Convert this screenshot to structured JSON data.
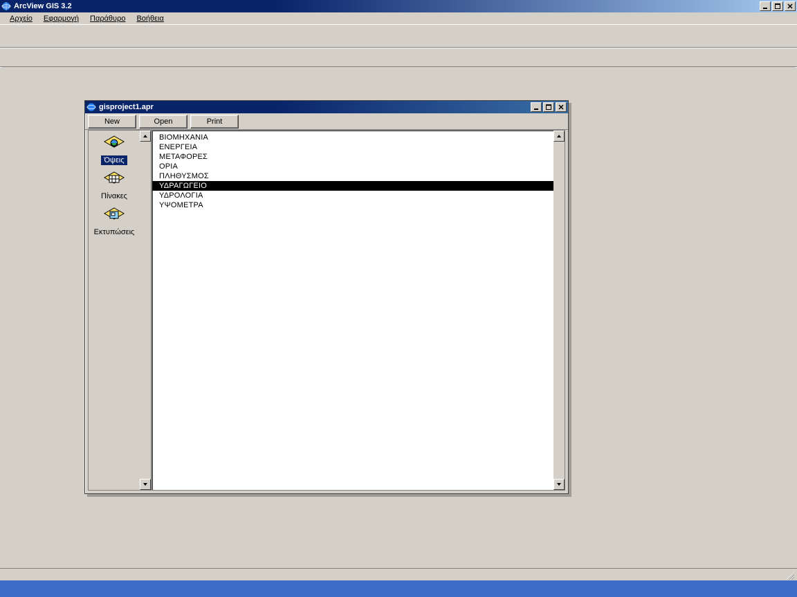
{
  "app": {
    "title": "ArcView GIS 3.2"
  },
  "menubar": {
    "items": [
      {
        "label": "Αρχείο"
      },
      {
        "label": "Εφαρμογή"
      },
      {
        "label": "Παράθυρο"
      },
      {
        "label": "Βοήθεια"
      }
    ]
  },
  "project_window": {
    "title": "gisproject1.apr",
    "buttons": {
      "new": "New",
      "open": "Open",
      "print": "Print"
    },
    "sidebar": {
      "items": [
        {
          "label": "Όψεις",
          "icon": "views-icon",
          "selected": true
        },
        {
          "label": "Πίνακες",
          "icon": "tables-icon",
          "selected": false
        },
        {
          "label": "Εκτυπώσεις",
          "icon": "layouts-icon",
          "selected": false
        }
      ]
    },
    "list": {
      "items": [
        {
          "label": "ΒΙΟΜΗΧΑΝΙΑ",
          "selected": false
        },
        {
          "label": "ΕΝΕΡΓΕΙΑ",
          "selected": false
        },
        {
          "label": "ΜΕΤΑΦΟΡΕΣ",
          "selected": false
        },
        {
          "label": "ΟΡΙΑ",
          "selected": false
        },
        {
          "label": "ΠΛΗΘΥΣΜΟΣ",
          "selected": false
        },
        {
          "label": "ΥΔΡΑΓΩΓΕΙΟ",
          "selected": true
        },
        {
          "label": "ΥΔΡΟΛΟΓΙΑ",
          "selected": false
        },
        {
          "label": "ΥΨΟΜΕΤΡΑ",
          "selected": false
        }
      ]
    }
  },
  "colors": {
    "titlebar_dark": "#0a246a",
    "titlebar_light": "#a6caf0",
    "face": "#d4d0c8",
    "selection": "#000000"
  }
}
